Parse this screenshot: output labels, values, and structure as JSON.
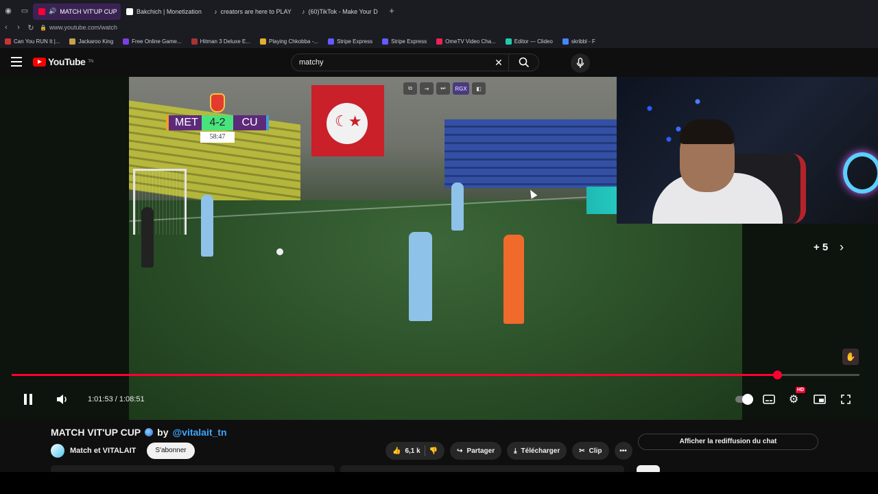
{
  "browser": {
    "tabs": [
      {
        "label": "MATCH VIT'UP CUP",
        "active": true,
        "color": "#ff0033"
      },
      {
        "label": "Bakchich | Monetization",
        "active": false,
        "color": "#ffffff"
      },
      {
        "label": "creators are here to PLAY",
        "active": false,
        "color": "#ffffff"
      },
      {
        "label": "(60)TikTok - Make Your D",
        "active": false,
        "color": "#ffffff"
      }
    ],
    "url": "www.youtube.com/watch",
    "bookmarks": [
      {
        "label": "Can You RUN It |...",
        "color": "#c33"
      },
      {
        "label": "Jackaroo King",
        "color": "#c9a04a"
      },
      {
        "label": "Free Online Game...",
        "color": "#7b3fe0"
      },
      {
        "label": "Hitman 3 Deluxe E...",
        "color": "#a33"
      },
      {
        "label": "Playing Chkobba -...",
        "color": "#e0b030"
      },
      {
        "label": "Stripe Express",
        "color": "#635bff"
      },
      {
        "label": "Stripe Express",
        "color": "#635bff"
      },
      {
        "label": "OmeTV Video Cha...",
        "color": "#e25"
      },
      {
        "label": "Editor — Clideo",
        "color": "#2ca"
      },
      {
        "label": "skribbl - F",
        "color": "#48f"
      }
    ]
  },
  "youtube": {
    "logo_text": "YouTube",
    "logo_region": "TN",
    "search_value": "matchy"
  },
  "video": {
    "scoreboard": {
      "home": "MET",
      "score": "4-2",
      "away": "CU",
      "clock": "58:47"
    },
    "overlay_tools": [
      "⧉",
      "⇥",
      "⏭",
      "RGX",
      "◧"
    ],
    "side_count": "+ 5",
    "progress_fraction": 0.903,
    "time_current": "1:01:53",
    "time_total": "1:08:51",
    "time_display": "1:01:53 / 1:08:51",
    "hd_badge": "HD"
  },
  "details": {
    "title": "MATCH VIT'UP CUP",
    "by": "by",
    "handle": "@vitalait_tn",
    "channel_name": "Match et VITALAIT",
    "subscribe": "S'abonner",
    "likes": "6,1 k",
    "share": "Partager",
    "download": "Télécharger",
    "clip": "Clip",
    "chat_replay": "Afficher la rediffusion du chat"
  }
}
